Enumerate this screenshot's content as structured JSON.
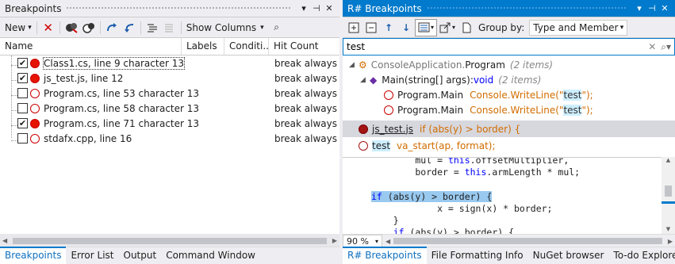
{
  "left": {
    "title": "Breakpoints",
    "title_controls": [
      "▾",
      "⊣",
      "✕"
    ],
    "toolbar": {
      "new_label": "New",
      "show_columns_label": "Show Columns"
    },
    "columns": [
      "Name",
      "Labels",
      "Conditi...",
      "Hit Count"
    ],
    "rows": [
      {
        "checked": true,
        "enabled": true,
        "name": "Class1.cs, line 9 character 13",
        "hit": "break always"
      },
      {
        "checked": true,
        "enabled": true,
        "name": "js_test.js, line 12",
        "hit": "break always"
      },
      {
        "checked": false,
        "enabled": false,
        "name": "Program.cs, line 53 character 13",
        "hit": "break always"
      },
      {
        "checked": false,
        "enabled": false,
        "name": "Program.cs, line 58 character 13",
        "hit": "break always"
      },
      {
        "checked": true,
        "enabled": true,
        "name": "Program.cs, line 71 character 13",
        "hit": "break always"
      },
      {
        "checked": false,
        "enabled": false,
        "name": "stdafx.cpp, line 16",
        "hit": "break always"
      }
    ],
    "tabs": [
      "Breakpoints",
      "Error List",
      "Output",
      "Command Window"
    ]
  },
  "right": {
    "title": "R# Breakpoints",
    "title_controls": [
      "▾",
      "⊣",
      "✕"
    ],
    "group_by_label": "Group by:",
    "group_by_value": "Type and Member",
    "search_value": "test",
    "tree": {
      "ns": "ConsoleApplication.",
      "cls": "Program",
      "cls_count": "(2 items)",
      "method": "Main(string[] args):",
      "method_ret": "void",
      "method_count": "(2 items)",
      "items": [
        {
          "loc": "Program.Main",
          "code_a": "Console.WriteLine(\"",
          "code_hl": "test",
          "code_b": "\");"
        },
        {
          "loc": "Program.Main",
          "code_a": "Console.WriteLine(\"",
          "code_hl": "test",
          "code_b": "\");"
        }
      ],
      "js_file": "js_test.js",
      "js_code": "if (abs(y) > border) {",
      "test_file": "test",
      "test_code": "va_start(ap, format);"
    },
    "code_lines": [
      {
        "pre": "        mul = ",
        "kw": "this",
        "post": ".offsetMultiplier,"
      },
      {
        "pre": "        border = ",
        "kw": "this",
        "post": ".armLength * mul;"
      },
      {
        "pre": "",
        "kw": "",
        "post": ""
      },
      {
        "pre": "",
        "kw": "",
        "post": ""
      },
      {
        "pre": "            x = sign(x) * border;",
        "kw": "",
        "post": ""
      },
      {
        "pre": "    }",
        "kw": "",
        "post": ""
      },
      {
        "pre": "    ",
        "kw": "if",
        "post": " (abs(y) > border) {"
      }
    ],
    "highlight_line": {
      "kw": "if",
      "post": " (abs(y) > border) {"
    },
    "zoom": "90 %",
    "tabs": [
      "R# Breakpoints",
      "File Formatting Info",
      "NuGet browser",
      "To-do Explorer"
    ]
  },
  "colors": {
    "accent": "#007acc",
    "breakpoint": "#e51400",
    "highlight": "#99c9ef",
    "keyword": "#0000ff",
    "string": "#a31515",
    "member_orange": "#d16d00"
  }
}
